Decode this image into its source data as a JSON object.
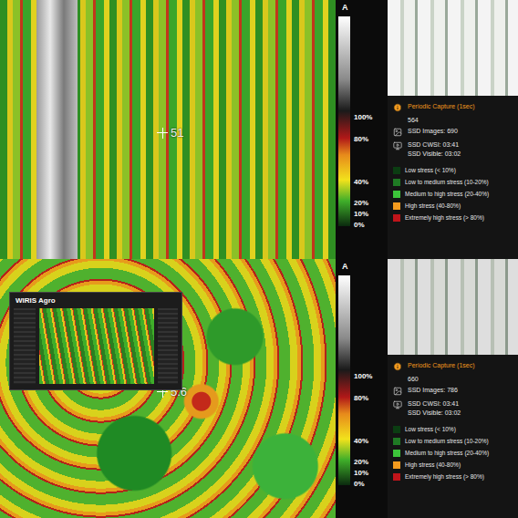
{
  "panels": [
    {
      "overlay_reading": "51",
      "inset": null,
      "scale": {
        "title": "A",
        "ticks": [
          {
            "label": "100%",
            "value": 100
          },
          {
            "label": "80%",
            "value": 80
          },
          {
            "label": "40%",
            "value": 40
          },
          {
            "label": "20%",
            "value": 20
          },
          {
            "label": "10%",
            "value": 10
          },
          {
            "label": "0%",
            "value": 0
          }
        ]
      },
      "capture": {
        "label": "Periodic Capture (1sec)",
        "count": "564"
      },
      "ssd_images": "SSD Images: 690",
      "ssd_times": [
        "SSD CWSI: 03:41",
        "SSD Visible: 03:02"
      ],
      "legend": [
        {
          "label": "Low stress (< 10%)",
          "color": "#0b3d12"
        },
        {
          "label": "Low to medium stress (10-20%)",
          "color": "#1f7a24"
        },
        {
          "label": "Medium to high stress (20-40%)",
          "color": "#3cc43a"
        },
        {
          "label": "High stress (40-80%)",
          "color": "#f39a1e"
        },
        {
          "label": "Extremely high stress (> 80%)",
          "color": "#c0141a"
        }
      ]
    },
    {
      "overlay_reading": "5.6",
      "inset": {
        "title": "WIRIS Agro"
      },
      "scale": {
        "title": "A",
        "ticks": [
          {
            "label": "100%",
            "value": 100
          },
          {
            "label": "80%",
            "value": 80
          },
          {
            "label": "40%",
            "value": 40
          },
          {
            "label": "20%",
            "value": 20
          },
          {
            "label": "10%",
            "value": 10
          },
          {
            "label": "0%",
            "value": 0
          }
        ]
      },
      "capture": {
        "label": "Periodic Capture (1sec)",
        "count": "660"
      },
      "ssd_images": "SSD Images: 786",
      "ssd_times": [
        "SSD CWSI: 03:41",
        "SSD Visible: 03:02"
      ],
      "legend": [
        {
          "label": "Low stress (< 10%)",
          "color": "#0b3d12"
        },
        {
          "label": "Low to medium stress (10-20%)",
          "color": "#1f7a24"
        },
        {
          "label": "Medium to high stress (20-40%)",
          "color": "#3cc43a"
        },
        {
          "label": "High stress (40-80%)",
          "color": "#f39a1e"
        },
        {
          "label": "Extremely high stress (> 80%)",
          "color": "#c0141a"
        }
      ]
    }
  ]
}
